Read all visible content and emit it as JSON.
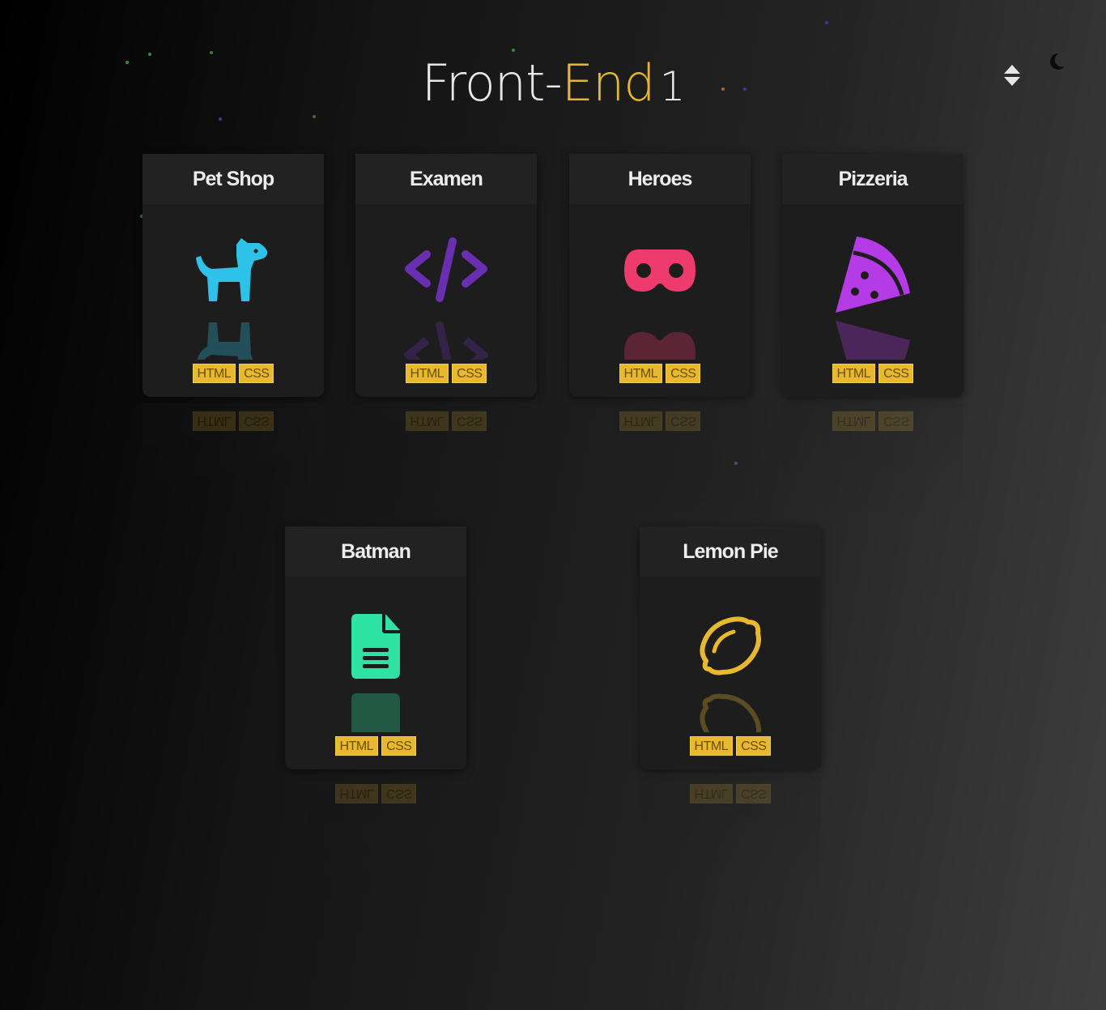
{
  "header": {
    "title_part1": "Front-",
    "title_accent": "End",
    "title_number": "1",
    "accent_color": "#e4b72c"
  },
  "controls": {
    "sort_icon": "sort-icon",
    "theme_icon": "moon-icon"
  },
  "projects": [
    {
      "title": "Pet Shop",
      "icon": "dog-icon",
      "color": "#2fc2e8",
      "tags": [
        "HTML",
        "CSS"
      ]
    },
    {
      "title": "Examen",
      "icon": "code-icon",
      "color": "#6a2fb0",
      "tags": [
        "HTML",
        "CSS"
      ]
    },
    {
      "title": "Heroes",
      "icon": "mask-icon",
      "color": "#ee3a6c",
      "tags": [
        "HTML",
        "CSS"
      ]
    },
    {
      "title": "Pizzeria",
      "icon": "pizza-icon",
      "color": "#b43be6",
      "tags": [
        "HTML",
        "CSS"
      ]
    },
    {
      "title": "Batman",
      "icon": "document-icon",
      "color": "#2ee3a3",
      "tags": [
        "HTML",
        "CSS"
      ]
    },
    {
      "title": "Lemon Pie",
      "icon": "lemon-icon",
      "color": "#e9b92d",
      "tags": [
        "HTML",
        "CSS"
      ]
    }
  ],
  "tag_color": "#e9b92d"
}
